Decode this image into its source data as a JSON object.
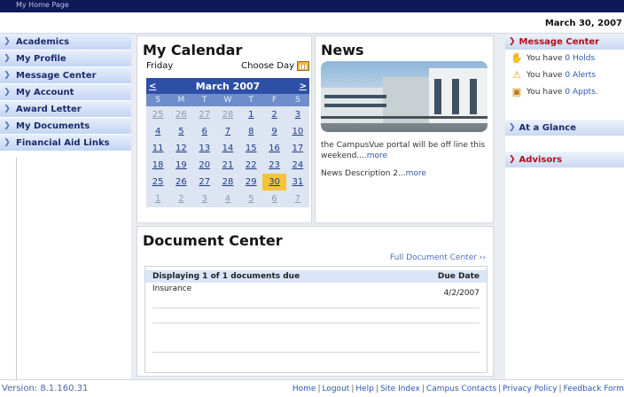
{
  "top_bar": {
    "title": "My Home Page"
  },
  "date": "March 30, 2007",
  "nav": [
    {
      "label": "Academics"
    },
    {
      "label": "My Profile"
    },
    {
      "label": "Message Center"
    },
    {
      "label": "My Account"
    },
    {
      "label": "Award Letter"
    },
    {
      "label": "My Documents"
    },
    {
      "label": "Financial Aid Links"
    }
  ],
  "calendar": {
    "title": "My Calendar",
    "weekday": "Friday",
    "choose_day": "Choose Day",
    "prev": "<",
    "next": ">",
    "month": "March 2007",
    "days": [
      "S",
      "M",
      "T",
      "W",
      "T",
      "F",
      "S"
    ],
    "dates": [
      "25",
      "26",
      "27",
      "28",
      "1",
      "2",
      "3",
      "4",
      "5",
      "6",
      "7",
      "8",
      "9",
      "10",
      "11",
      "12",
      "13",
      "14",
      "15",
      "16",
      "17",
      "18",
      "19",
      "20",
      "21",
      "22",
      "23",
      "24",
      "25",
      "26",
      "27",
      "28",
      "29",
      "30",
      "31",
      "1",
      "2",
      "3",
      "4",
      "5",
      "6",
      "7"
    ],
    "selected": "30"
  },
  "news": {
    "title": "News",
    "item1_text": "the CampusVue portal will be off line this weekend....",
    "item1_more": "more",
    "item2_text": "News Description 2...",
    "item2_more": "more"
  },
  "documents": {
    "title": "Document Center",
    "full_link": "Full Document Center ››",
    "header_left": "Displaying 1 of 1 documents due",
    "header_right": "Due Date",
    "rows": [
      {
        "name": "Insurance",
        "due": "4/2/2007"
      }
    ]
  },
  "right": {
    "message_center": {
      "title": "Message Center",
      "holds_prefix": "You have",
      "holds_count": "0",
      "holds_label": "Holds",
      "alerts_prefix": "You have",
      "alerts_count": "0",
      "alerts_label": "Alerts",
      "appts_prefix": "You have",
      "appts_count": "0",
      "appts_label": "Appts."
    },
    "at_a_glance": "At a Glance",
    "advisors": "Advisors"
  },
  "footer": {
    "version": "Version: 8.1.160.31",
    "links": [
      "Home",
      "Logout",
      "Help",
      "Site Index",
      "Campus Contacts",
      "Privacy Policy",
      "Feedback Form"
    ]
  }
}
